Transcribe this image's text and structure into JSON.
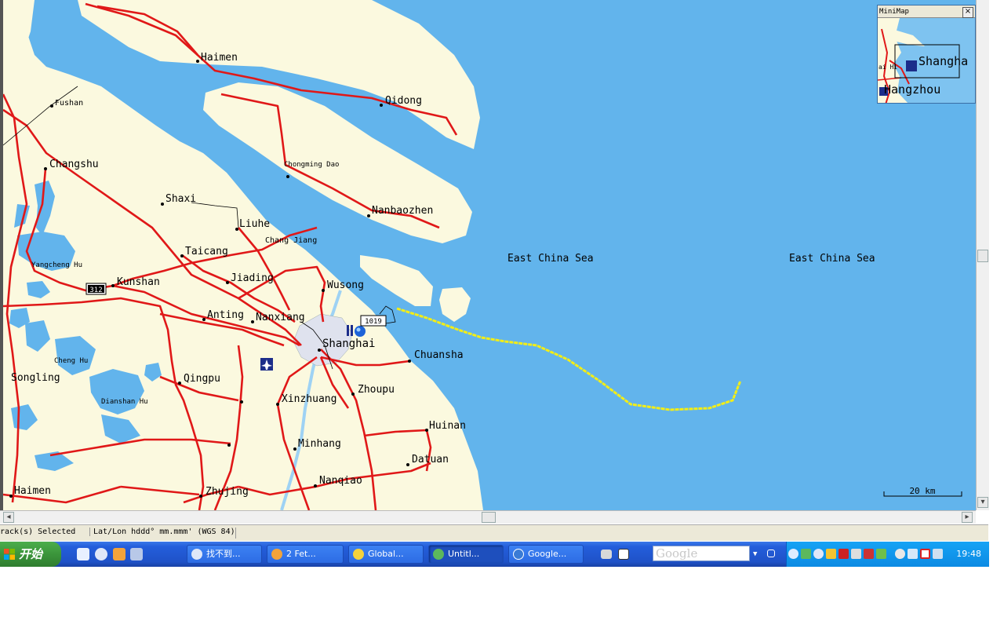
{
  "colors": {
    "sea": "#62b4ec",
    "land": "#fbf9df",
    "road": "#e01818",
    "track": "#f3ee16",
    "city_area": "#dfe2ee"
  },
  "map": {
    "places": {
      "haimen_n": "Haimen",
      "fushan": "Fushan",
      "qidong": "Qidong",
      "changshu": "Changshu",
      "chongming_dao": "Chongming Dao",
      "shaxi": "Shaxi",
      "nanbaozhen": "Nanbaozhen",
      "liuhe": "Liuhe",
      "chang_jiang": "Chang Jiang",
      "taicang": "Taicang",
      "yangcheng_hu": "Yangcheng Hu",
      "kunshan": "Kunshan",
      "jiading": "Jiading",
      "wusong": "Wusong",
      "anting": "Anting",
      "nanxiang": "Nanxiang",
      "shanghai": "Shanghai",
      "chuansha": "Chuansha",
      "cheng_hu": "Cheng Hu",
      "songling": "Songling",
      "qingpu": "Qingpu",
      "dianshan_hu": "Dianshan Hu",
      "xinzhuang": "Xinzhuang",
      "zhoupu": "Zhoupu",
      "huinan": "Huinan",
      "minhang": "Minhang",
      "datuan": "Datuan",
      "haimen_s": "Haimen",
      "zhujing": "Zhujing",
      "nanqiao": "Nanqiao",
      "sea_label_1": "East China Sea",
      "sea_label_2": "East China Sea"
    },
    "route_shields": {
      "r312": "312",
      "r1019": "1019"
    },
    "scale_label": "20 km"
  },
  "minimap": {
    "title": "MiniMap",
    "close": "×",
    "labels": {
      "shanghai": "Shangha",
      "hangzhou": "Hangzhou",
      "haihi": "ai Hi"
    }
  },
  "statusbar": {
    "selection": "rack(s) Selected",
    "position_format": "Lat/Lon hddd° mm.mmm' (WGS 84)"
  },
  "taskbar": {
    "start_label": "开始",
    "buttons": [
      {
        "label": "找不到..."
      },
      {
        "label": "2 Fet..."
      },
      {
        "label": "Global..."
      },
      {
        "label": "Untitl..."
      },
      {
        "label": "Google..."
      }
    ],
    "search_placeholder": "Google",
    "clock": "19:48"
  }
}
